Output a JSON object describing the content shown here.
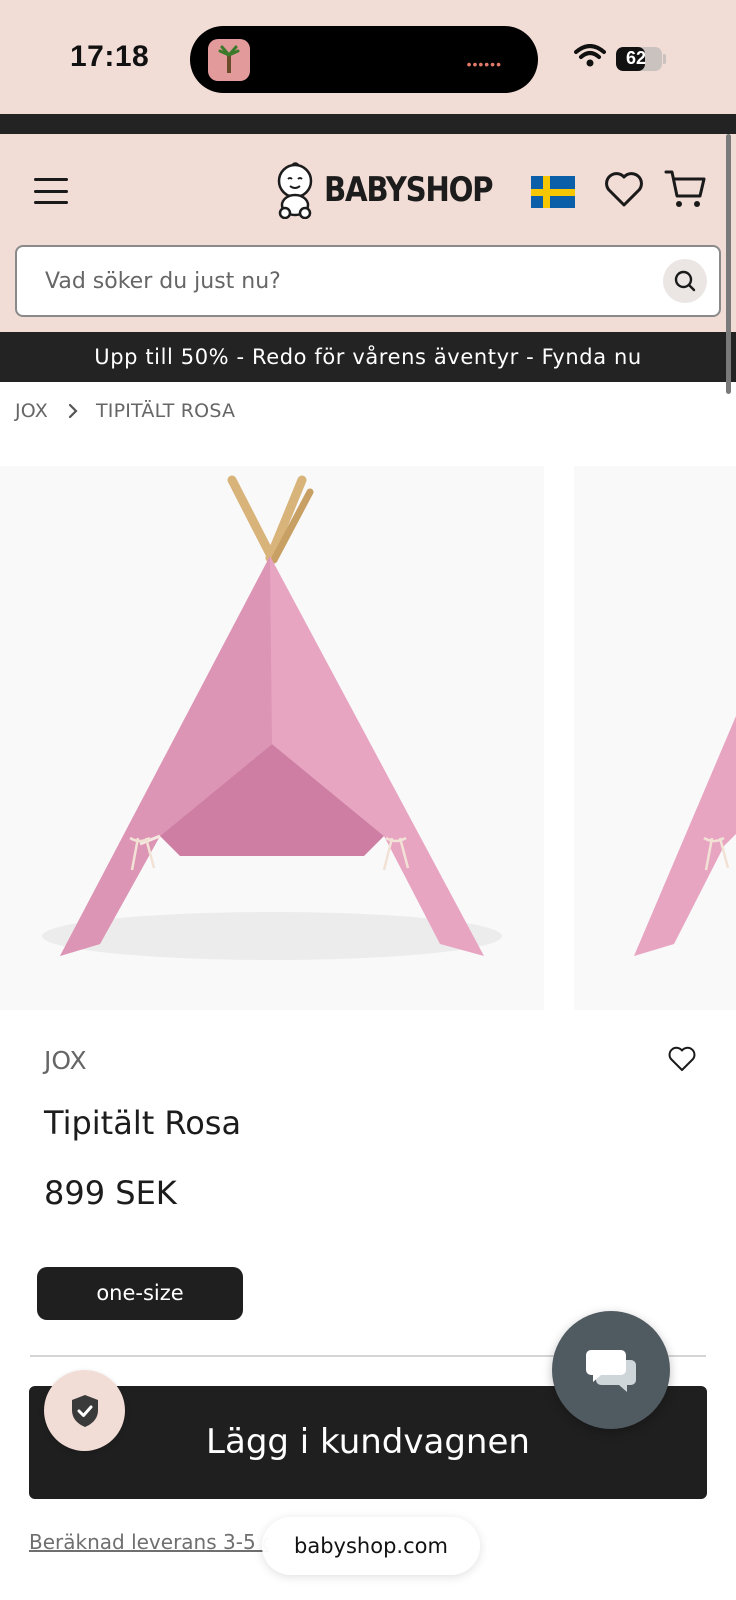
{
  "status_bar": {
    "time": "17:18",
    "battery": "62",
    "battery_level": 0.62
  },
  "header": {
    "logo_text": "BABYSHOP",
    "search": {
      "placeholder": "Vad söker du just nu?"
    },
    "icons": [
      "menu-icon",
      "sweden-flag-icon",
      "heart-icon",
      "cart-icon",
      "search-icon"
    ]
  },
  "promo": {
    "text": "Upp till 50% - Redo för vårens äventyr - Fynda nu"
  },
  "breadcrumb": {
    "items": [
      "JOX",
      "TIPITÄLT ROSA"
    ]
  },
  "product": {
    "brand": "JOX",
    "title": "Tipitält Rosa",
    "price": "899 SEK",
    "size_option": "one-size",
    "add_to_cart": "Lägg i kundvagnen",
    "delivery": "Beräknad leverans 3-5 d"
  },
  "browser": {
    "url": "babyshop.com"
  },
  "colors": {
    "header_bg": "#f2dcd6",
    "dark": "#232323",
    "tent_pink": "#e8a5c2",
    "chat_button": "#505a61"
  }
}
